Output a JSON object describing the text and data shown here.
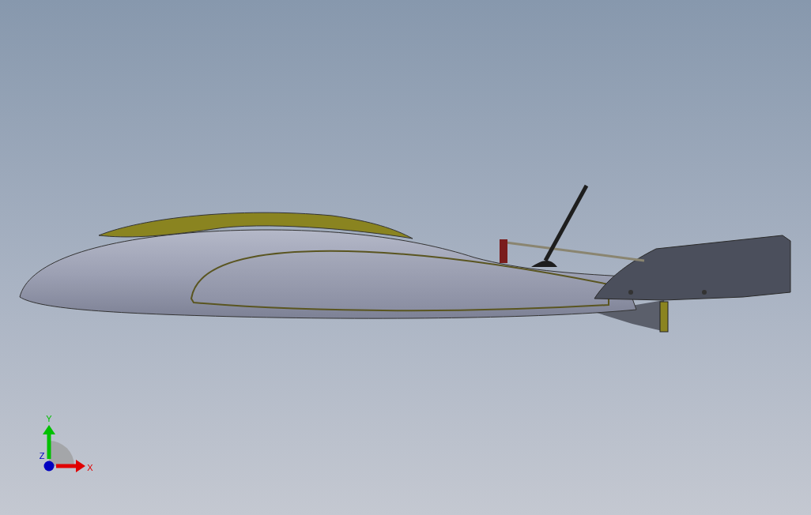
{
  "viewport": {
    "model": {
      "kind": "aircraft"
    },
    "triad": {
      "axes": [
        {
          "kind": "y",
          "label": "Y",
          "color": "#00c000"
        },
        {
          "kind": "x",
          "label": "X",
          "color": "#e00000"
        },
        {
          "kind": "z",
          "label": "Z",
          "color": "#0000c0"
        }
      ]
    }
  }
}
